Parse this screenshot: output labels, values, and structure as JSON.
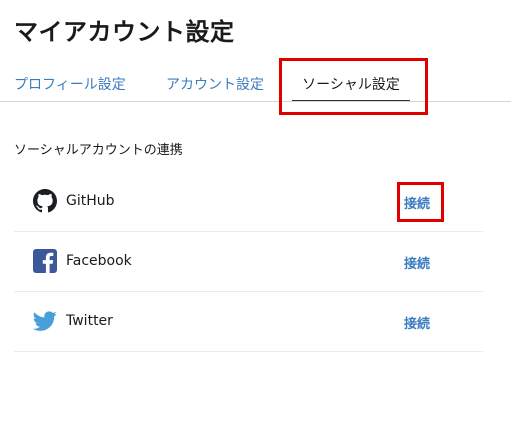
{
  "page": {
    "title": "マイアカウント設定"
  },
  "tabs": [
    {
      "label": "プロフィール設定",
      "active": false
    },
    {
      "label": "アカウント設定",
      "active": false
    },
    {
      "label": "ソーシャル設定",
      "active": true
    }
  ],
  "social": {
    "heading": "ソーシャルアカウントの連携",
    "accounts": [
      {
        "name": "GitHub",
        "icon": "github-icon",
        "action": "接続"
      },
      {
        "name": "Facebook",
        "icon": "facebook-icon",
        "action": "接続"
      },
      {
        "name": "Twitter",
        "icon": "twitter-icon",
        "action": "接続"
      }
    ]
  },
  "colors": {
    "link": "#3a7cbf",
    "highlight": "#e00000",
    "facebook": "#3b5998",
    "twitter": "#4a9fd8"
  }
}
